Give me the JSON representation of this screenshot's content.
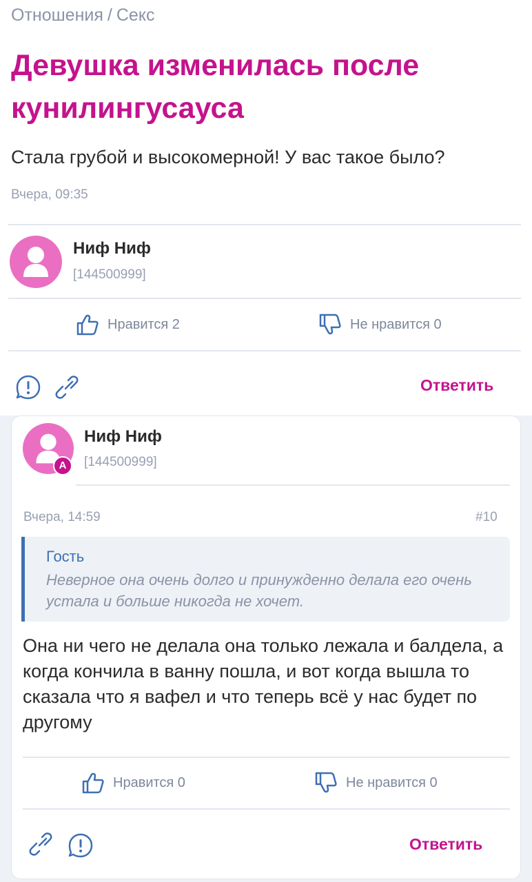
{
  "breadcrumb": {
    "category": "Отношения",
    "separator": "/",
    "subcategory": "Секс"
  },
  "question": {
    "title": "Девушка изменилась после кунилингусауса",
    "body": "Стала грубой и высокомерной! У вас такое было?",
    "date": "Вчера, 09:35",
    "author": {
      "name": "Ниф Ниф",
      "id": "[144500999]",
      "avatar": "user-silhouette-icon"
    },
    "likes_label": "Нравится 2",
    "dislikes_label": "Не нравится 0",
    "reply_label": "Ответить"
  },
  "answer": {
    "author": {
      "name": "Ниф Ниф",
      "id": "[144500999]",
      "badge": "А",
      "avatar": "user-silhouette-icon"
    },
    "date": "Вчера, 14:59",
    "number": "#10",
    "quote": {
      "author": "Гость",
      "text": "Неверное она очень долго и принужденно делала его очень устала и больше никогда не хочет."
    },
    "body": "Она ни чего не делала она только лежала и балдела, а когда кончила в ванну пошла, и вот когда вышла то сказала что я вафел и что теперь всё у нас будет по другому",
    "likes_label": "Нравится 0",
    "dislikes_label": "Не нравится 0",
    "reply_label": "Ответить"
  },
  "colors": {
    "accent": "#c4138c",
    "avatar": "#ea6fc3",
    "quote_border": "#3d6fb3",
    "muted": "#98a0b2",
    "page_bg": "#eef1f6"
  }
}
